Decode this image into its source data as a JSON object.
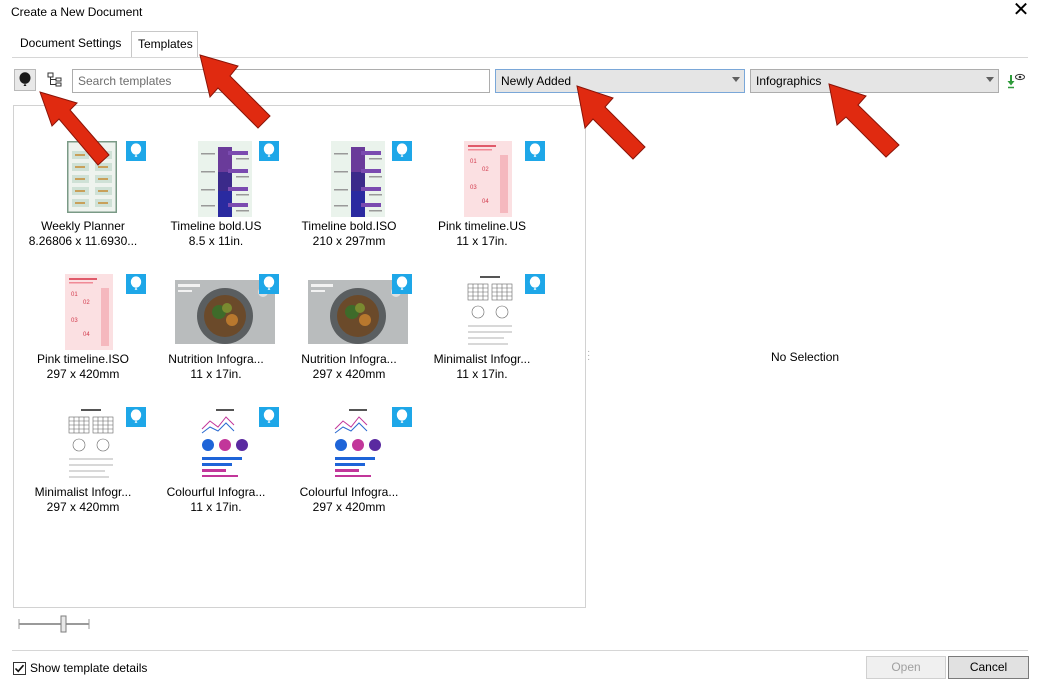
{
  "window": {
    "title": "Create a New Document",
    "close_glyph": "✕"
  },
  "tabs": [
    {
      "label": "Document Settings",
      "active": false
    },
    {
      "label": "Templates",
      "active": true
    }
  ],
  "toolbar": {
    "favorite_icon": "balloon-icon",
    "tree_icon": "tree-view-icon",
    "search_placeholder": "Search templates",
    "sort_value": "Newly Added",
    "category_value": "Infographics",
    "download_icon": "download-eye-icon"
  },
  "templates": [
    {
      "name": "Weekly Planner",
      "size": "8.26806 x 11.6930...",
      "thumb": "planner"
    },
    {
      "name": "Timeline bold.US",
      "size": "8.5 x 11in.",
      "thumb": "timeline"
    },
    {
      "name": "Timeline bold.ISO",
      "size": "210 x 297mm",
      "thumb": "timeline"
    },
    {
      "name": "Pink timeline.US",
      "size": "11 x 17in.",
      "thumb": "pink"
    },
    {
      "name": "Pink timeline.ISO",
      "size": "297 x 420mm",
      "thumb": "pink"
    },
    {
      "name": "Nutrition Infogra...",
      "size": "11 x 17in.",
      "thumb": "food"
    },
    {
      "name": "Nutrition Infogra...",
      "size": "297 x 420mm",
      "thumb": "food"
    },
    {
      "name": "Minimalist Infogr...",
      "size": "11 x 17in.",
      "thumb": "minimal"
    },
    {
      "name": "Minimalist Infogr...",
      "size": "297 x 420mm",
      "thumb": "minimal"
    },
    {
      "name": "Colourful Infogra...",
      "size": "11 x 17in.",
      "thumb": "colourful"
    },
    {
      "name": "Colourful Infogra...",
      "size": "297 x 420mm",
      "thumb": "colourful"
    }
  ],
  "details": {
    "no_selection": "No Selection"
  },
  "footer": {
    "show_details_label": "Show template details",
    "show_details_checked": true,
    "open_label": "Open",
    "cancel_label": "Cancel"
  },
  "colors": {
    "accent": "#1ea7e8",
    "annotation_arrow": "#e02a10"
  }
}
